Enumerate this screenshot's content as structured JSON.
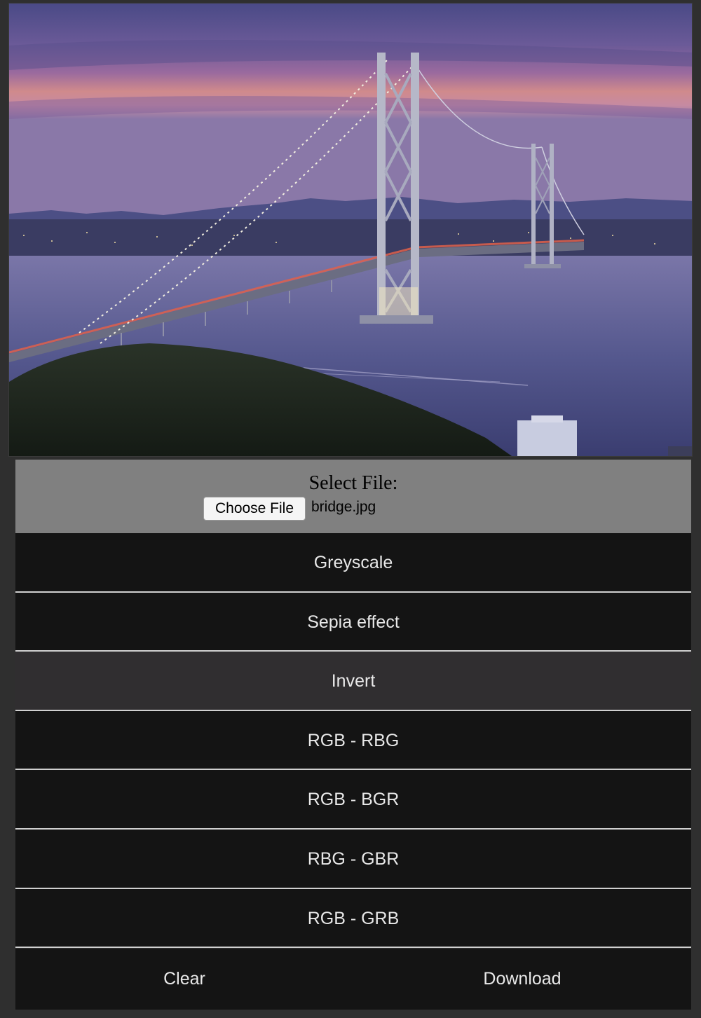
{
  "file_panel": {
    "label": "Select File:",
    "button_label": "Choose File",
    "file_name": "bridge.jpg"
  },
  "filters": [
    {
      "label": "Greyscale"
    },
    {
      "label": "Sepia effect"
    },
    {
      "label": "Invert",
      "hovered": true
    },
    {
      "label": "RGB - RBG"
    },
    {
      "label": "RGB - BGR"
    },
    {
      "label": "RBG - GBR"
    },
    {
      "label": "RGB - GRB"
    }
  ],
  "actions": {
    "clear_label": "Clear",
    "download_label": "Download"
  },
  "colors": {
    "button_bg": "#141414",
    "button_hover_bg": "#302e30",
    "panel_bg": "#808080",
    "divider": "#d0d0d0"
  }
}
